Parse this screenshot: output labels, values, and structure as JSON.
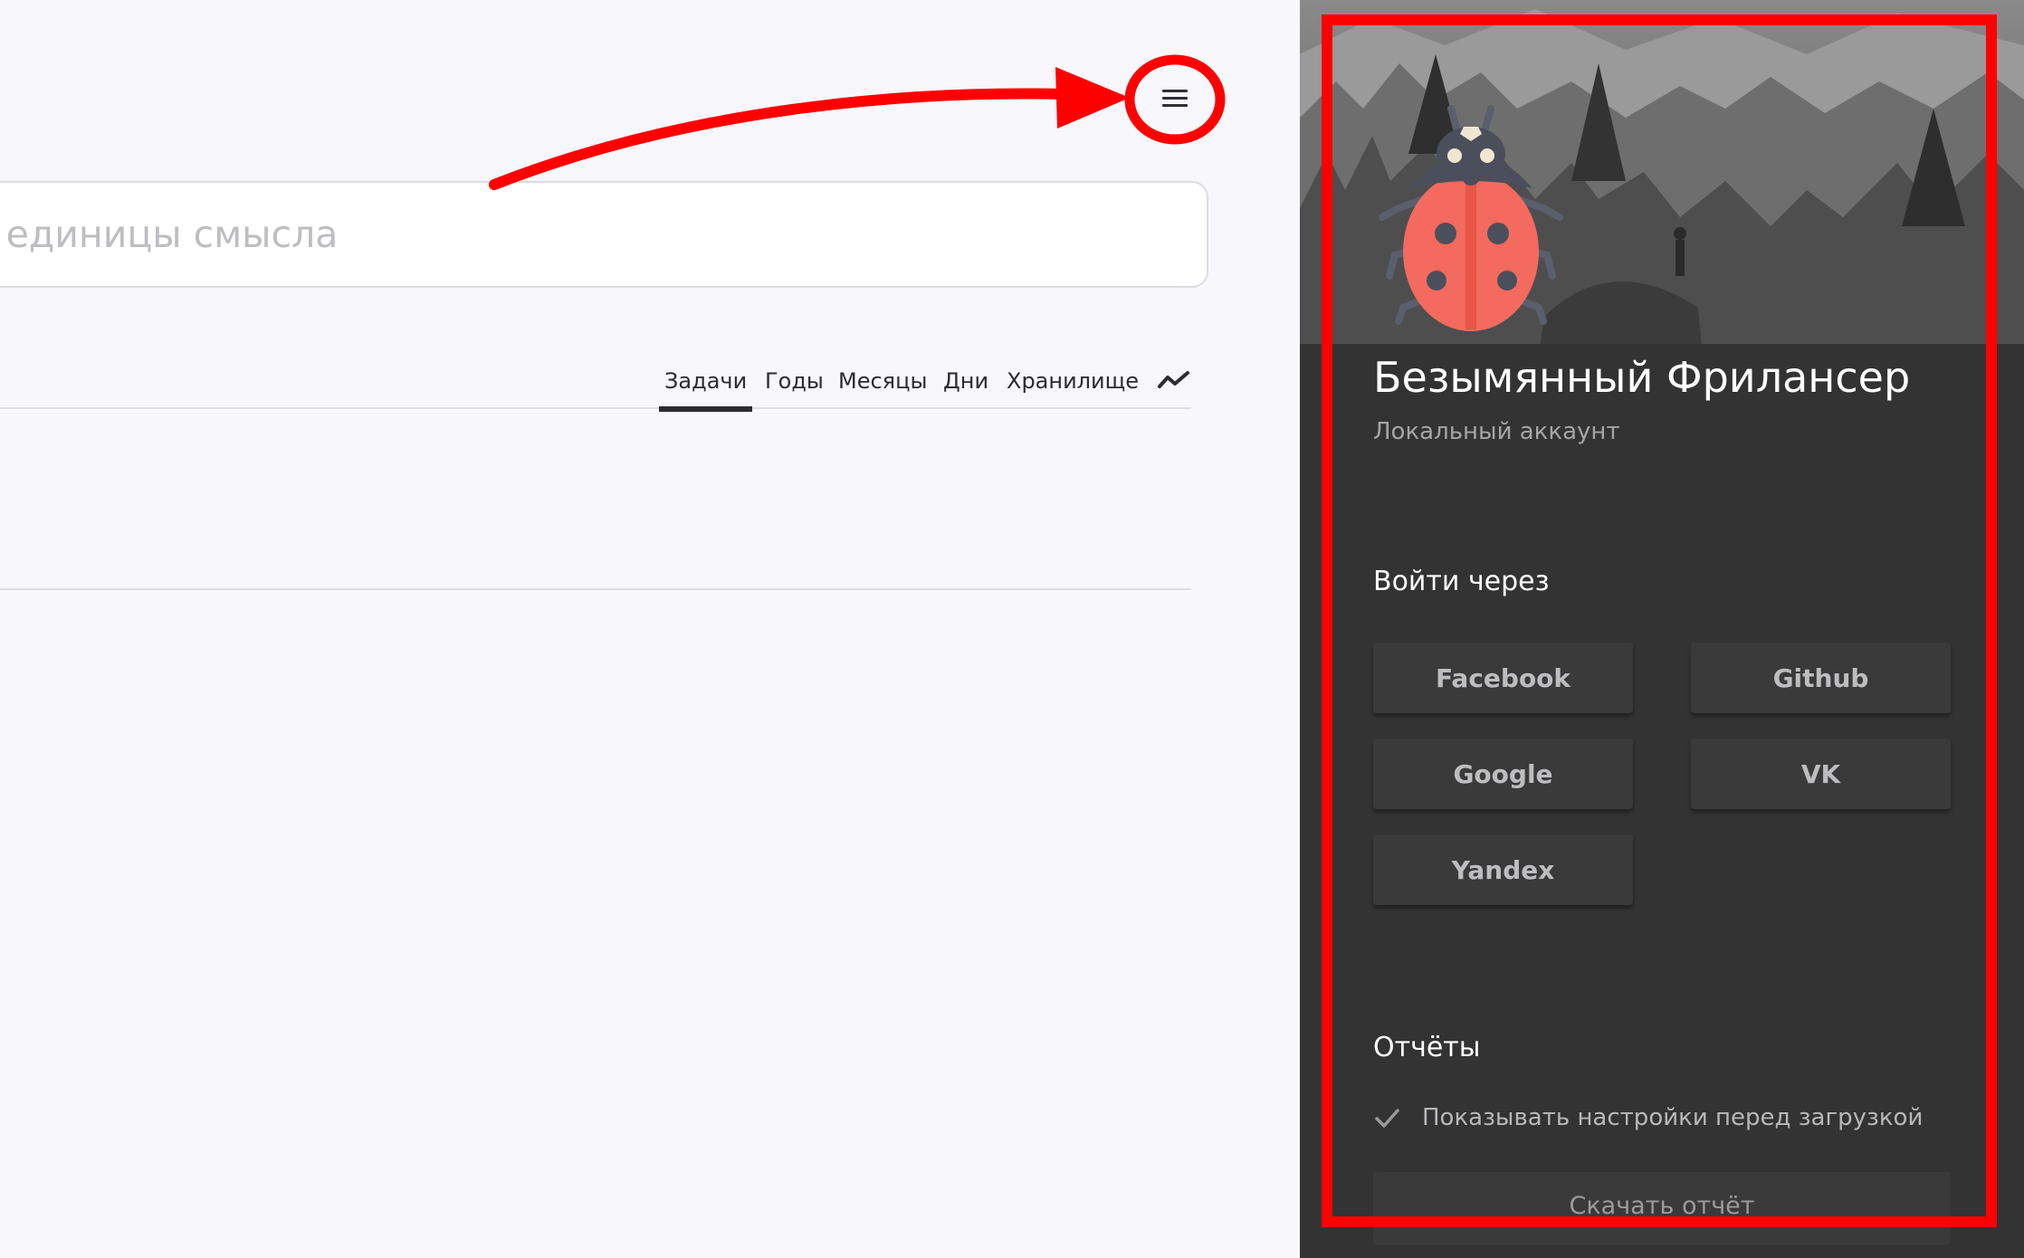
{
  "search": {
    "placeholder": "и единицы смысла"
  },
  "tabs": [
    {
      "label": "Задачи",
      "active": true
    },
    {
      "label": "Годы",
      "active": false
    },
    {
      "label": "Месяцы",
      "active": false
    },
    {
      "label": "Дни",
      "active": false
    },
    {
      "label": "Хранилище",
      "active": false
    }
  ],
  "icons": {
    "menu": "hamburger-menu-icon",
    "trend": "trend-line-icon",
    "avatar": "ladybug-icon",
    "check": "checkmark-icon"
  },
  "drawer": {
    "user_name": "Безымянный Фрилансер",
    "account_type": "Локальный аккаунт",
    "login_title": "Войти через",
    "login_buttons": [
      "Facebook",
      "Github",
      "Google",
      "VK",
      "Yandex"
    ],
    "reports_title": "Отчёты",
    "show_settings_label": "Показывать настройки перед загрузкой",
    "show_settings_checked": true,
    "download_label": "Скачать отчёт"
  },
  "colors": {
    "page_bg": "#f7f7fc",
    "drawer_bg": "#333334",
    "annotation_red": "#ff0000",
    "ladybug_red": "#f46a5e"
  }
}
